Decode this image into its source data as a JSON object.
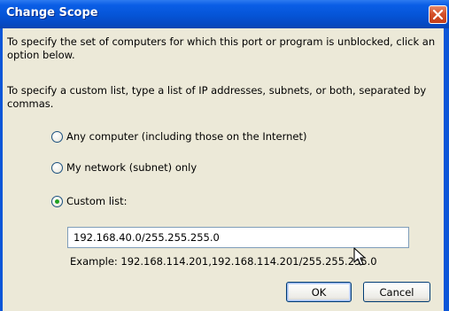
{
  "window": {
    "title": "Change Scope",
    "close_icon": "close-icon"
  },
  "text": {
    "paragraph1": "To specify the set of computers for which this port or program is unblocked, click an option below.",
    "paragraph2": "To specify a custom list, type a list of IP addresses, subnets, or both, separated by commas."
  },
  "options": [
    {
      "label": "Any computer (including those on the Internet)",
      "selected": false
    },
    {
      "label": "My network (subnet) only",
      "selected": false
    },
    {
      "label": "Custom list:",
      "selected": true
    }
  ],
  "custom_list": {
    "value": "192.168.40.0/255.255.255.0",
    "example": "Example: 192.168.114.201,192.168.114.201/255.255.255.0"
  },
  "buttons": {
    "ok": "OK",
    "cancel": "Cancel"
  },
  "colors": {
    "title_bar": "#0554d6",
    "dialog_face": "#ece9d8",
    "close_button": "#d5512a",
    "radio_selected": "#21a121"
  },
  "cursor_icon": "mouse-pointer-icon"
}
